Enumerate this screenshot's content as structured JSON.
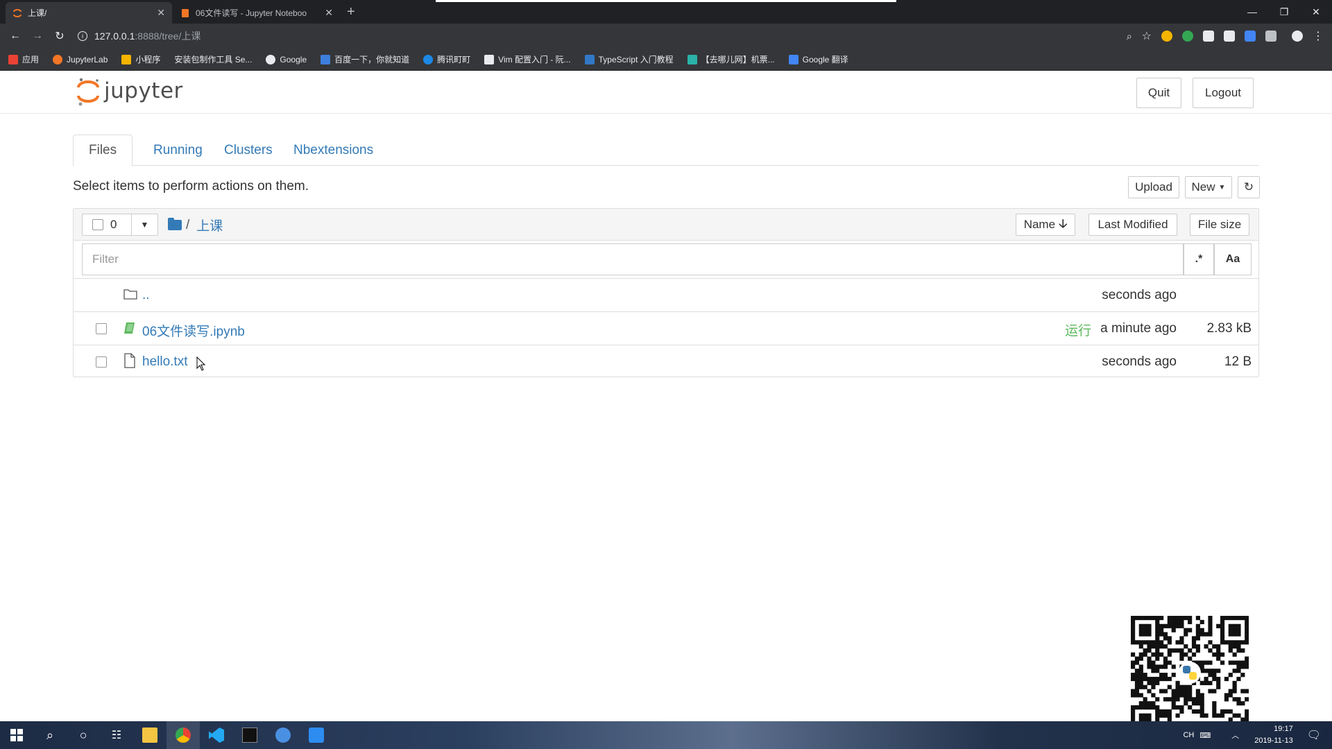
{
  "browser": {
    "tabs": [
      {
        "title": "上课/",
        "active": true
      },
      {
        "title": "06文件读写 - Jupyter Noteboo",
        "active": false
      }
    ],
    "url_host": "127.0.0.1",
    "url_path": ":8888/tree/上课",
    "bookmarks": [
      "应用",
      "JupyterLab",
      "小程序",
      "安装包制作工具 Se...",
      "Google",
      "百度一下，你就知道",
      "腾讯町町",
      "Vim 配置入门 - 阮...",
      "TypeScript 入门教程",
      "【去哪儿网】机票...",
      "Google 翻译"
    ]
  },
  "jupyter": {
    "logo_text": "jupyter",
    "quit_label": "Quit",
    "logout_label": "Logout",
    "tabs": [
      "Files",
      "Running",
      "Clusters",
      "Nbextensions"
    ],
    "notice": "Select items to perform actions on them.",
    "upload_label": "Upload",
    "new_label": "New",
    "selected_count": "0",
    "breadcrumb_sep": "/",
    "current_dir": "上课",
    "sort_name": "Name",
    "sort_modified": "Last Modified",
    "sort_size": "File size",
    "filter_placeholder": "Filter",
    "regex_label": ".*",
    "case_label": "Aa",
    "items": [
      {
        "name": "..",
        "type": "folder",
        "status": "",
        "modified": "seconds ago",
        "size": ""
      },
      {
        "name": "06文件读写.ipynb",
        "type": "notebook",
        "status": "运行",
        "modified": "a minute ago",
        "size": "2.83 kB"
      },
      {
        "name": "hello.txt",
        "type": "file",
        "status": "",
        "modified": "seconds ago",
        "size": "12 B"
      }
    ]
  },
  "taskbar": {
    "tray_lang": "CH",
    "time": "19:17",
    "date": "2019-11-13"
  },
  "colors": {
    "link": "#337ab7",
    "running": "#5cb85c",
    "jupyter_orange": "#f37626"
  }
}
